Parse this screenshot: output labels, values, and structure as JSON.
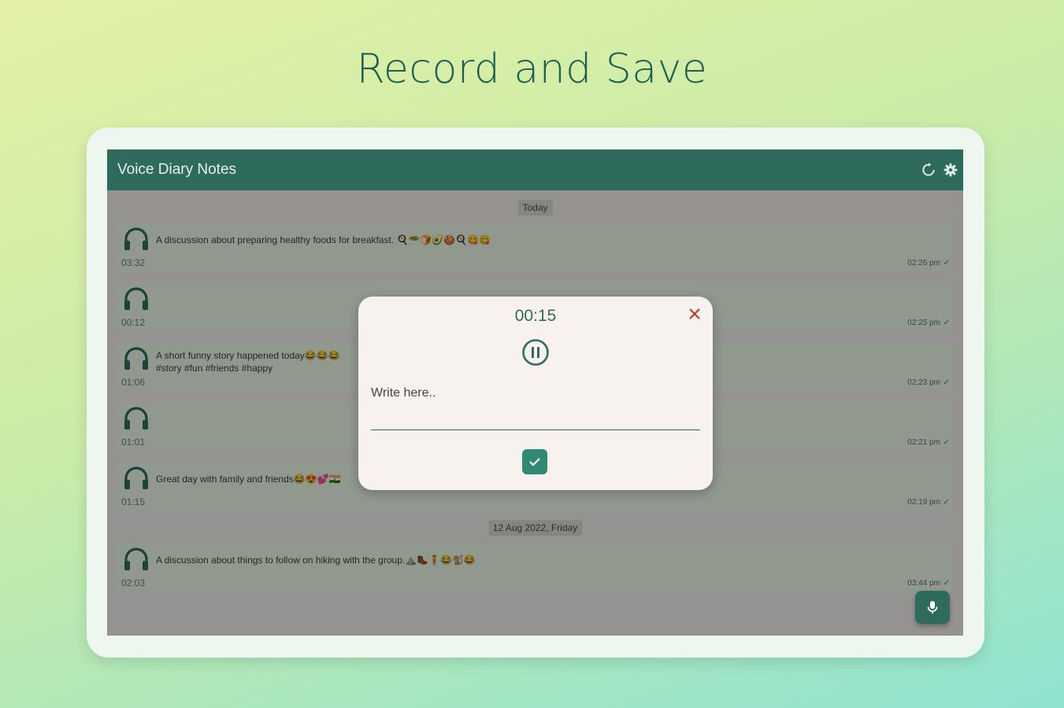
{
  "headline": "Record and Save",
  "app": {
    "title": "Voice Diary Notes",
    "icons": [
      "sync-icon",
      "settings-icon"
    ]
  },
  "sections": [
    {
      "date": "Today",
      "notes": [
        {
          "text": "A discussion about preparing healthy foods for breakfast. 🍳🥗🍞🥑🍪🍳😋😋",
          "duration": "03:32",
          "time": "02:26 pm"
        },
        {
          "text": "",
          "duration": "00:12",
          "time": "02:25 pm"
        },
        {
          "text": "A short funny story happened today😂😂😂 #story #fun #friends #happy",
          "duration": "01:06",
          "time": "02:23 pm"
        },
        {
          "text": "",
          "duration": "01:01",
          "time": "02:21 pm"
        },
        {
          "text": "Great day with family and friends😂😍💕🇮🇳",
          "duration": "01:15",
          "time": "02:19 pm"
        }
      ]
    },
    {
      "date": "12 Aug 2022, Friday",
      "notes": [
        {
          "text": "A discussion about things to follow on hiking with the group.⛰️🥾🧍😂🐒😂",
          "duration": "02:03",
          "time": "03:44 pm"
        }
      ]
    }
  ],
  "dialog": {
    "timer": "00:15",
    "placeholder": "Write here.."
  },
  "colors": {
    "primary": "#2f6b5c",
    "note_bg": "#eaf7e6",
    "close": "#c0392b"
  }
}
